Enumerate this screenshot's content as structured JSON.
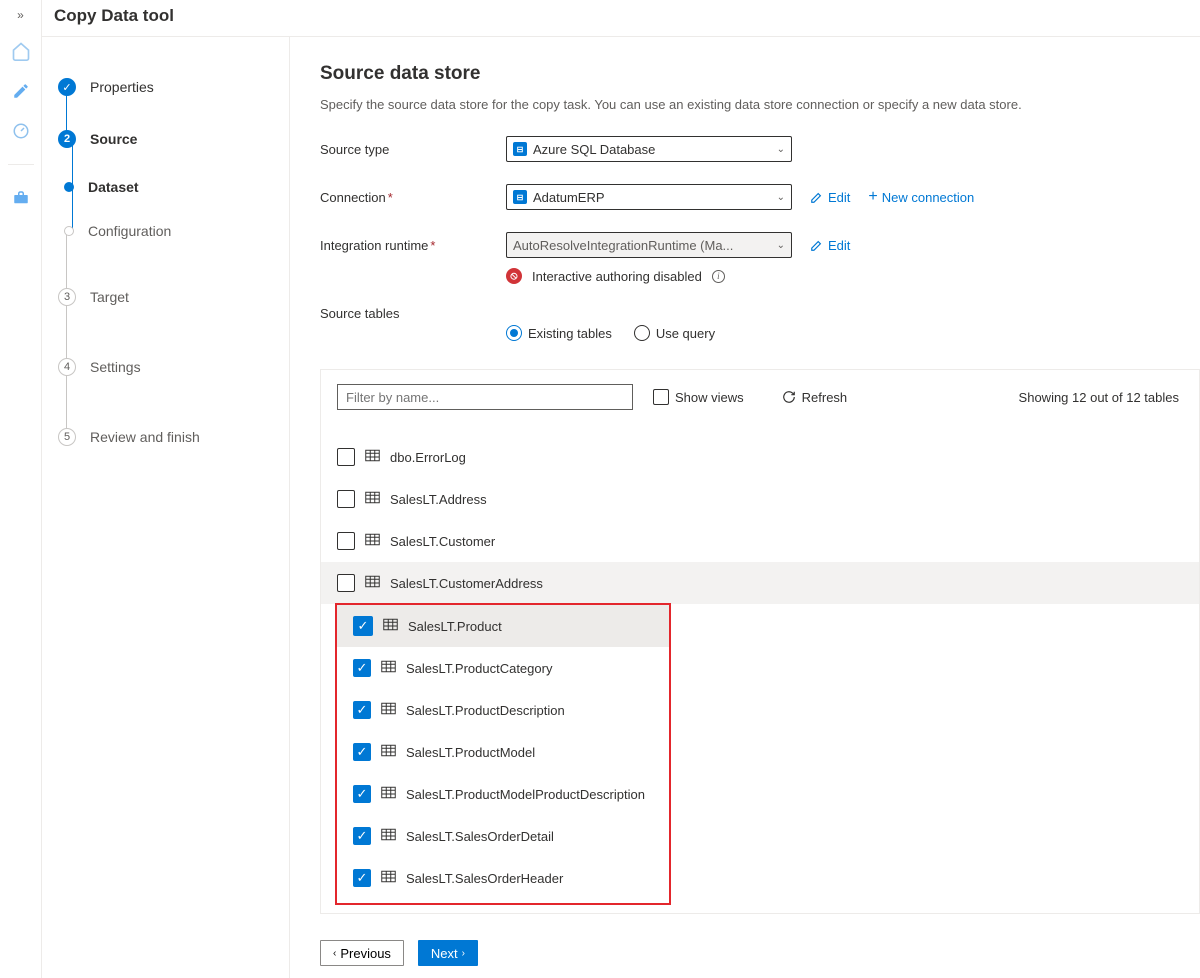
{
  "page_title": "Copy Data tool",
  "rail_icons": [
    "home",
    "pencil",
    "gauge",
    "toolbox"
  ],
  "steps": [
    {
      "label": "Properties",
      "state": "done",
      "kind": "major"
    },
    {
      "label": "Source",
      "state": "active",
      "kind": "major",
      "num": "2"
    },
    {
      "label": "Dataset",
      "state": "active",
      "kind": "sub"
    },
    {
      "label": "Configuration",
      "state": "future",
      "kind": "sub"
    },
    {
      "label": "Target",
      "state": "future",
      "kind": "major",
      "num": "3"
    },
    {
      "label": "Settings",
      "state": "future",
      "kind": "major",
      "num": "4"
    },
    {
      "label": "Review and finish",
      "state": "future",
      "kind": "major",
      "num": "5"
    }
  ],
  "form": {
    "title": "Source data store",
    "desc": "Specify the source data store for the copy task. You can use an existing data store connection or specify a new data store.",
    "source_type_lbl": "Source type",
    "source_type_val": "Azure SQL Database",
    "connection_lbl": "Connection",
    "connection_val": "AdatumERP",
    "edit": "Edit",
    "new_conn": "New connection",
    "ir_lbl": "Integration runtime",
    "ir_val": "AutoResolveIntegrationRuntime (Ma...",
    "ia_disabled": "Interactive authoring disabled",
    "source_tables_lbl": "Source tables",
    "radio_existing": "Existing tables",
    "radio_query": "Use query"
  },
  "tables_panel": {
    "filter_placeholder": "Filter by name...",
    "show_views": "Show views",
    "refresh": "Refresh",
    "count": "Showing 12 out of 12 tables",
    "rows": [
      {
        "name": "dbo.ErrorLog",
        "checked": false
      },
      {
        "name": "SalesLT.Address",
        "checked": false
      },
      {
        "name": "SalesLT.Customer",
        "checked": false
      },
      {
        "name": "SalesLT.CustomerAddress",
        "checked": false,
        "hover": true
      },
      {
        "name": "SalesLT.Product",
        "checked": true,
        "highlight_first": true
      },
      {
        "name": "SalesLT.ProductCategory",
        "checked": true
      },
      {
        "name": "SalesLT.ProductDescription",
        "checked": true
      },
      {
        "name": "SalesLT.ProductModel",
        "checked": true
      },
      {
        "name": "SalesLT.ProductModelProductDescription",
        "checked": true
      },
      {
        "name": "SalesLT.SalesOrderDetail",
        "checked": true
      },
      {
        "name": "SalesLT.SalesOrderHeader",
        "checked": true
      }
    ]
  },
  "footer": {
    "prev": "Previous",
    "next": "Next"
  }
}
